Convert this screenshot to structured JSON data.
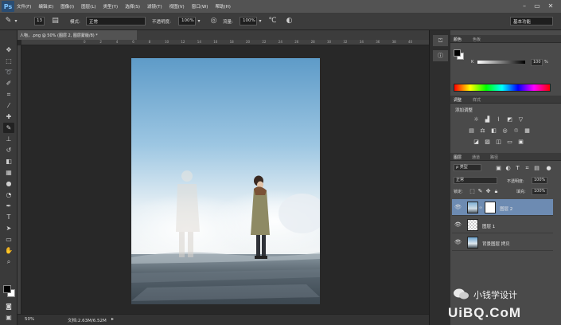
{
  "app": {
    "logo_text": "Ps"
  },
  "menu": [
    "文件(F)",
    "编辑(E)",
    "图像(I)",
    "图层(L)",
    "类型(Y)",
    "选择(S)",
    "滤镜(T)",
    "视图(V)",
    "窗口(W)",
    "帮助(H)"
  ],
  "options": {
    "brush_size": "13",
    "mode_label": "模式:",
    "mode_value": "正常",
    "opacity_label": "不透明度:",
    "opacity_value": "100%",
    "flow_label": "流量:",
    "flow_value": "100%",
    "workspace": "基本功能"
  },
  "document": {
    "tab_title": "人物，.png @ 50% (图层 2, 图层蒙版/8) *",
    "ruler_ticks": [
      "0",
      "2",
      "4",
      "6",
      "8",
      "10",
      "12",
      "14",
      "16",
      "18",
      "20",
      "22",
      "24",
      "26",
      "28",
      "30",
      "32",
      "34",
      "36",
      "38",
      "40",
      "42",
      "44"
    ],
    "zoom": "50%",
    "doc_info": "文档:2.63M/6.52M"
  },
  "color_panel": {
    "tabs": [
      "颜色",
      "色板"
    ],
    "channel": "K",
    "value": "100",
    "percent": "%"
  },
  "adjustments_panel": {
    "tabs": [
      "调整",
      "样式"
    ],
    "add_label": "添加调整"
  },
  "layers_panel": {
    "tabs": [
      "图层",
      "通道",
      "路径"
    ],
    "kind_filter": "ρ 类型",
    "blend_mode": "正常",
    "opacity_label": "不透明度:",
    "opacity_value": "100%",
    "lock_label": "锁定:",
    "fill_label": "填充:",
    "fill_value": "100%",
    "layers": [
      {
        "name": "图层 2",
        "selected": true
      },
      {
        "name": "图层 1",
        "selected": false
      },
      {
        "name": "背景图层 拷贝",
        "selected": false
      }
    ]
  },
  "watermark": {
    "line1": "小钱学设计",
    "line2": "UiBQ.CoM"
  },
  "colors": {
    "ui_dark": "#282828",
    "panel": "#4a4a4a",
    "selected_layer": "#6d8bb2",
    "foreground": "#000000",
    "background": "#ffffff"
  }
}
